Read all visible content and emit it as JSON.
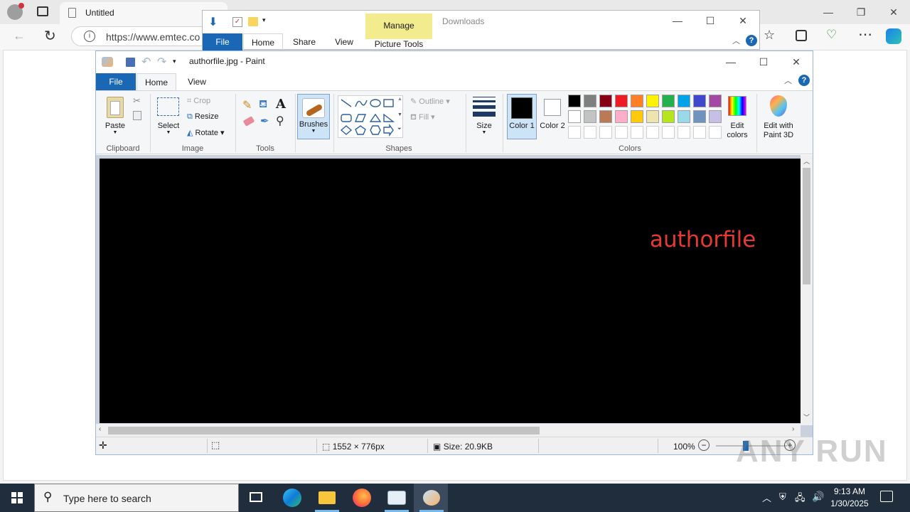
{
  "edge": {
    "tab_title": "Untitled",
    "url": "https://www.emtec.co"
  },
  "explorer": {
    "contextual_tab": "Manage",
    "window_title": "Downloads",
    "contextual_group": "Picture Tools",
    "tabs": [
      "File",
      "Home",
      "Share",
      "View"
    ]
  },
  "paint": {
    "title": "authorfile.jpg - Paint",
    "tabs": [
      "File",
      "Home",
      "View"
    ],
    "clipboard": {
      "paste": "Paste",
      "group": "Clipboard"
    },
    "image": {
      "select": "Select",
      "crop": "Crop",
      "resize": "Resize",
      "rotate": "Rotate",
      "group": "Image"
    },
    "tools": {
      "group": "Tools"
    },
    "brushes": "Brushes",
    "shapes": {
      "outline": "Outline",
      "fill": "Fill",
      "group": "Shapes"
    },
    "size": "Size",
    "color1": "Color 1",
    "color2": "Color 2",
    "colors_group": "Colors",
    "edit_colors": "Edit colors",
    "edit_3d": "Edit with Paint 3D",
    "palette_row1": [
      "#000000",
      "#7f7f7f",
      "#880015",
      "#ed1c24",
      "#ff7f27",
      "#fff200",
      "#22b14c",
      "#00a2e8",
      "#3f48cc",
      "#a349a4"
    ],
    "palette_row2": [
      "#ffffff",
      "#c3c3c3",
      "#b97a57",
      "#ffaec9",
      "#ffc90e",
      "#efe4b0",
      "#b5e61d",
      "#99d9ea",
      "#7092be",
      "#c8bfe7"
    ],
    "canvas_text": "authorfile",
    "status": {
      "dimensions": "1552 × 776px",
      "size": "Size: 20.9KB",
      "zoom": "100%"
    }
  },
  "taskbar": {
    "search_placeholder": "Type here to search",
    "time": "9:13 AM",
    "date": "1/30/2025"
  },
  "watermark": "ANY RUN"
}
